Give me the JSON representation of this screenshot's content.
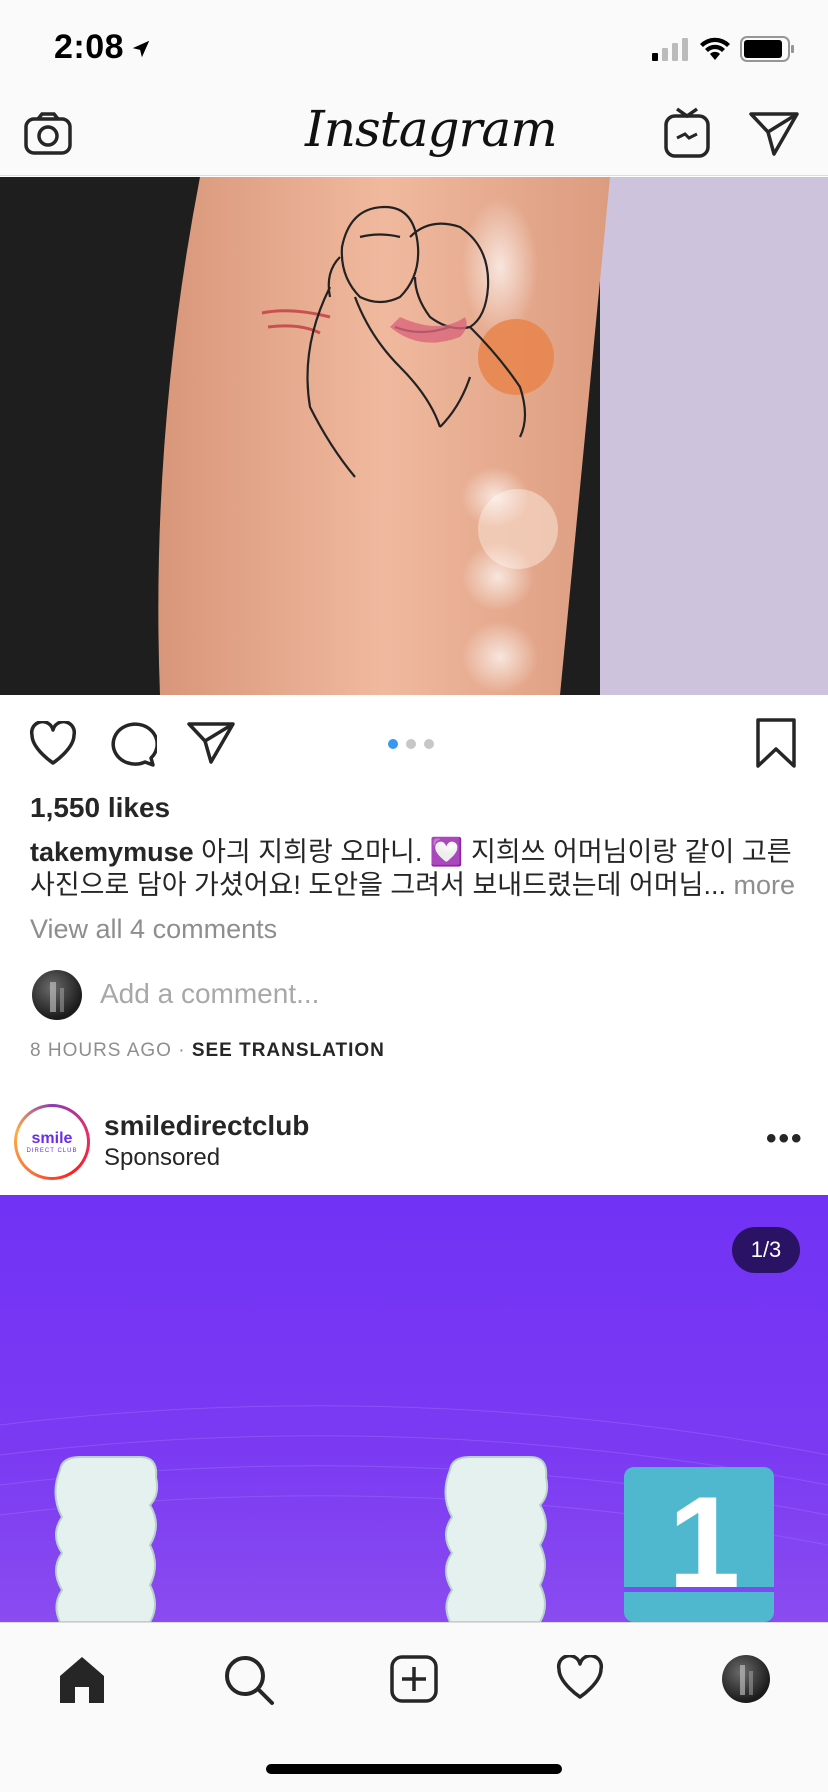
{
  "status_bar": {
    "time": "2:08"
  },
  "header": {
    "logo": "Instagram",
    "icons": [
      "camera-icon",
      "igtv-icon",
      "direct-icon"
    ]
  },
  "post1": {
    "likes": "1,550 likes",
    "username": "takemymuse",
    "caption_text": " 아긔 지희랑 오마니. 💟 지희쓰 어머님이랑 같이 고른 사진으로 담아 가셨어요! 도안을 그려서 보내드렸는데 어머님...",
    "more_label": " more",
    "view_comments": "View all 4 comments",
    "add_comment_placeholder": "Add a comment...",
    "timestamp": "8 HOURS AGO",
    "separator": " · ",
    "see_translation": "SEE TRANSLATION",
    "carousel": {
      "count": 3,
      "active": 1
    }
  },
  "post2": {
    "avatar_text": "smile",
    "avatar_subtext": "DIRECT CLUB",
    "username": "smiledirectclub",
    "subtitle": "Sponsored",
    "more_icon": "•••",
    "counter": "1/3",
    "step_number": "1"
  },
  "tab_bar": {
    "items": [
      "home-icon",
      "search-icon",
      "new-post-icon",
      "activity-icon",
      "profile-avatar"
    ]
  },
  "colors": {
    "accent": "#3897f0",
    "ad_bg": "#7132f5",
    "text": "#262626",
    "muted": "#8e8e8e"
  }
}
